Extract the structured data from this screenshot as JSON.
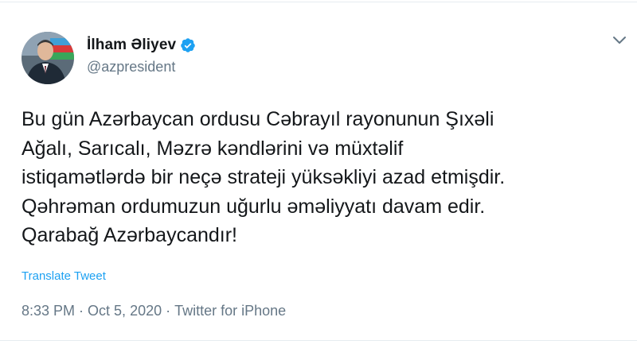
{
  "author": {
    "display_name": "İlham Əliyev",
    "handle": "@azpresident",
    "verified": true,
    "avatar_icon": "profile-photo"
  },
  "icons": {
    "verified": "verified-badge-icon",
    "caret": "chevron-down-icon"
  },
  "tweet": {
    "lines": [
      "Bu gün Azərbaycan ordusu Cəbrayıl rayonunun Şıxəli",
      "Ağalı, Sarıcalı, Məzrə kəndlərini və müxtəlif",
      "istiqamətlərdə bir neçə strateji yüksəkliyi azad etmişdir.",
      "Qəhrəman ordumuzun uğurlu əməliyyatı davam edir.",
      "Qarabağ Azərbaycandır!"
    ],
    "translate_label": "Translate Tweet"
  },
  "meta": {
    "time": "8:33 PM",
    "date": "Oct 5, 2020",
    "source": "Twitter for iPhone",
    "separator": "·"
  },
  "colors": {
    "text": "#14171a",
    "secondary": "#657786",
    "link": "#1da1f2",
    "divider": "#e6ecf0",
    "verified": "#1da1f2"
  }
}
